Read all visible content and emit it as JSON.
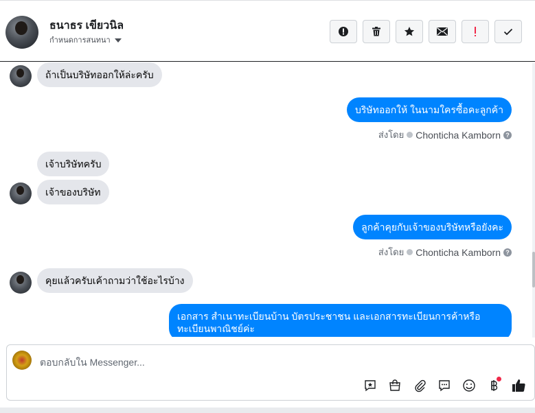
{
  "header": {
    "name": "ธนาธร เขียวนิล",
    "subtitle": "กำหนดการสนทนา"
  },
  "actions": [
    {
      "name": "alert-icon"
    },
    {
      "name": "trash-icon"
    },
    {
      "name": "star-icon"
    },
    {
      "name": "mail-icon"
    },
    {
      "name": "important-icon"
    },
    {
      "name": "check-icon"
    }
  ],
  "messages": {
    "m1": "ถ้าเป็นบริษัทออกให้ล่ะครับ",
    "m2": "บริษัทออกให้ ในนามใครซื้อคะลูกค้า",
    "m3": "เจ้าบริษัทครับ",
    "m4": "เจ้าของบริษัท",
    "m5": "ลูกค้าคุยกับเจ้าของบริษัทหรือยังคะ",
    "m6": "คุยแล้วครับเค้าถามว่าใช้อะไรบ้าง",
    "m7a": "เอกสาร สำเนาทะเบียนบ้าน บัตรประชาชน และเอกสารทะเบียนการค้าหรือ",
    "m7b": "ทะเบียนพาณิชย์ค่ะ"
  },
  "sent_by": {
    "label": "ส่งโดย",
    "agent": "Chonticha Kamborn",
    "help": "?"
  },
  "composer": {
    "placeholder": "ตอบกลับใน Messenger..."
  },
  "colors": {
    "outgoing": "#0084ff",
    "incoming": "#e4e6eb",
    "important": "#f02849"
  }
}
